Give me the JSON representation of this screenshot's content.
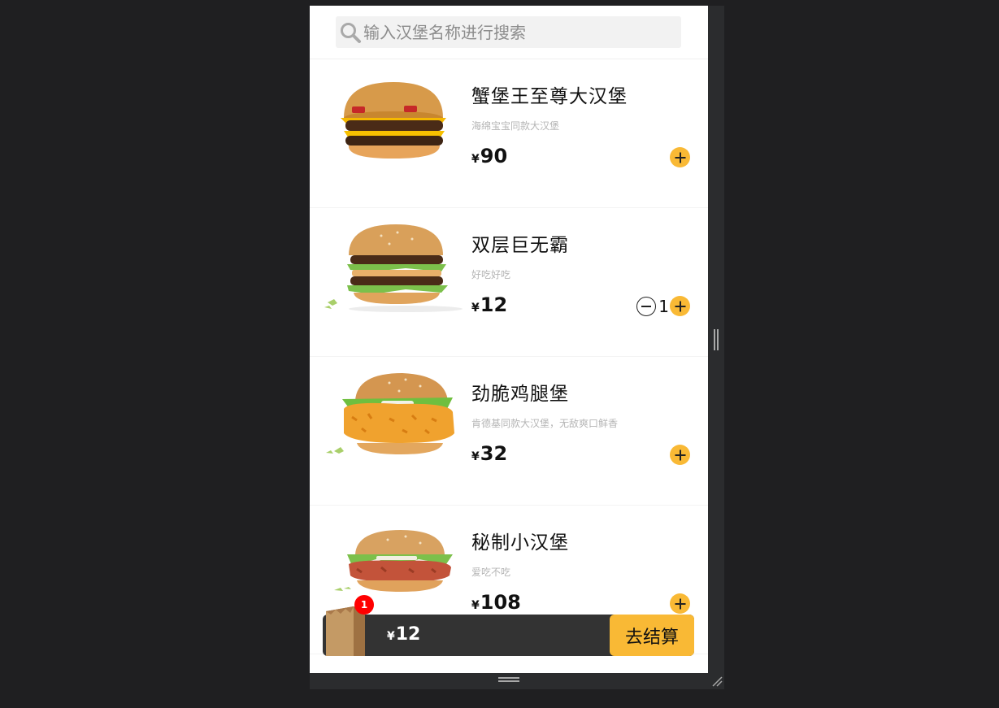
{
  "search": {
    "placeholder": "输入汉堡名称进行搜索",
    "icon": "search-icon"
  },
  "products": [
    {
      "name": "蟹堡王至尊大汉堡",
      "desc": "海绵宝宝同款大汉堡",
      "currency": "¥",
      "price": "90",
      "qty": "",
      "image": "burger-double-cheese-image"
    },
    {
      "name": "双层巨无霸",
      "desc": "好吃好吃",
      "currency": "¥",
      "price": "12",
      "qty": "1",
      "image": "burger-big-mac-image"
    },
    {
      "name": "劲脆鸡腿堡",
      "desc": "肯德基同款大汉堡，无敌爽口鲜香",
      "currency": "¥",
      "price": "32",
      "qty": "",
      "image": "burger-crispy-chicken-image"
    },
    {
      "name": "秘制小汉堡",
      "desc": "爱吃不吃",
      "currency": "¥",
      "price": "108",
      "qty": "",
      "image": "burger-secret-image"
    }
  ],
  "cart": {
    "count": "1",
    "currency": "¥",
    "total": "12",
    "checkout_label": "去结算",
    "icon": "shopping-bag-icon"
  },
  "colors": {
    "accent": "#f9b935",
    "cart_bar": "#333333",
    "badge": "#ff0000",
    "frame_bg": "#1f1f21"
  }
}
